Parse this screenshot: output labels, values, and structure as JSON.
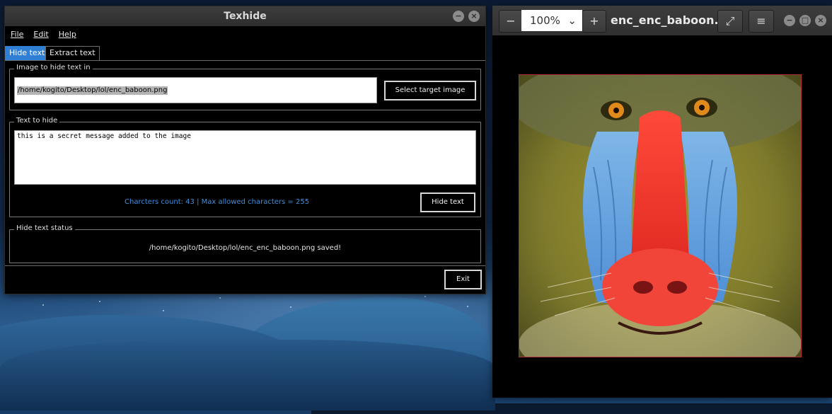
{
  "texhide": {
    "title": "Texhide",
    "menu": {
      "file": "File",
      "edit": "Edit",
      "help": "Help"
    },
    "tabs": {
      "hide": "Hide text",
      "extract": "Extract text"
    },
    "image_group": {
      "legend": "Image to hide text in",
      "path_value": "/home/kogito/Desktop/lol/enc_baboon.png",
      "select_button": "Select target image"
    },
    "text_group": {
      "legend": "Text to hide",
      "text_value": "this is a secret message added to the image",
      "counter": "Charcters count: 43 | Max allowed characters = 255",
      "hide_button": "Hide text"
    },
    "status_group": {
      "legend": "Hide text status",
      "message": "/home/kogito/Desktop/lol/enc_enc_baboon.png saved!"
    },
    "exit_button": "Exit",
    "window_buttons": {
      "minimize": "−",
      "close": "×"
    }
  },
  "viewer": {
    "title": "enc_enc_baboon.p...",
    "zoom_value": "100%",
    "zoom_minus": "−",
    "zoom_plus": "+",
    "zoom_chevron": "⌄",
    "fullscreen_icon": "⤢",
    "menu_icon": "≡",
    "window_buttons": {
      "minimize": "−",
      "maximize": "□",
      "close": "×"
    }
  },
  "colors": {
    "accent_tab": "#2f7fd4",
    "counter_text": "#3f8fe0",
    "image_border": "#b52c2c"
  }
}
